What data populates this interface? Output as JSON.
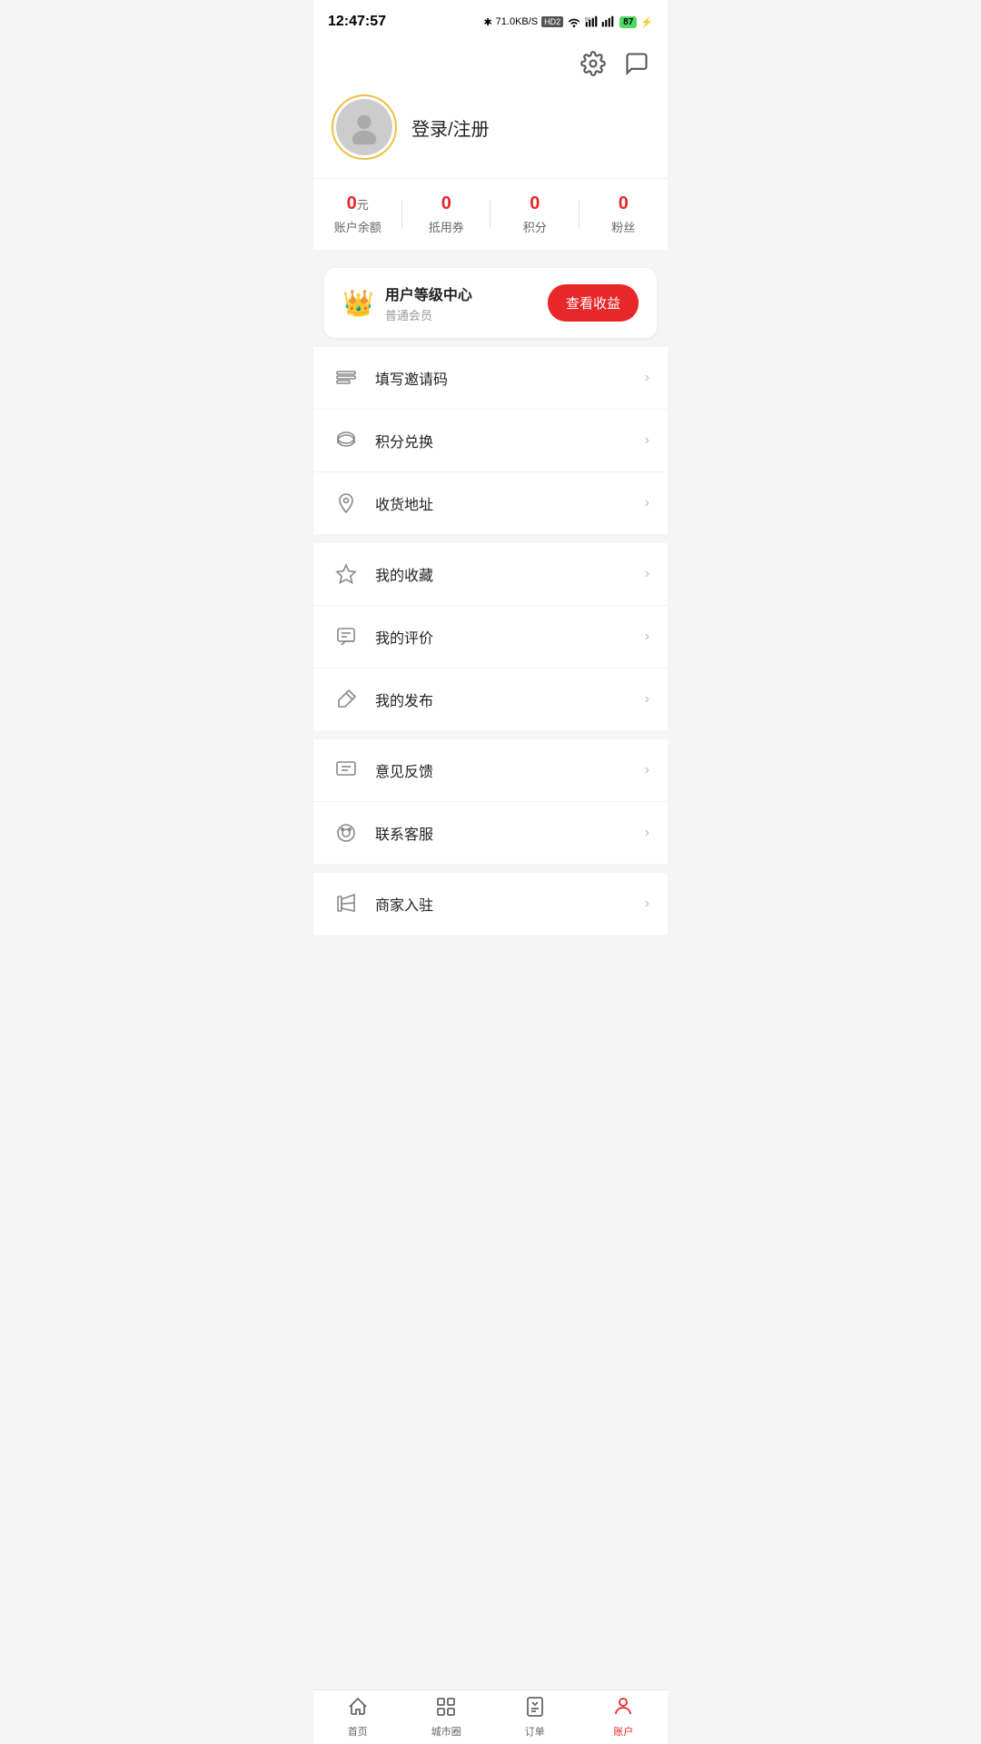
{
  "statusBar": {
    "time": "12:47:57",
    "battery": "87",
    "icons": "bluetooth signal wifi 5g"
  },
  "header": {
    "settingsLabel": "settings",
    "messageLabel": "message"
  },
  "profile": {
    "loginText": "登录/注册",
    "avatarAlt": "avatar"
  },
  "stats": [
    {
      "value": "0",
      "unit": "元",
      "label": "账户余额"
    },
    {
      "value": "0",
      "unit": "",
      "label": "抵用券"
    },
    {
      "value": "0",
      "unit": "",
      "label": "积分"
    },
    {
      "value": "0",
      "unit": "",
      "label": "粉丝"
    }
  ],
  "levelCard": {
    "title": "用户等级中心",
    "subtitle": "普通会员",
    "btnLabel": "查看收益"
  },
  "menuGroups": [
    {
      "items": [
        {
          "id": "invite-code",
          "label": "填写邀请码",
          "icon": "invite"
        },
        {
          "id": "points-exchange",
          "label": "积分兑换",
          "icon": "points"
        },
        {
          "id": "shipping-address",
          "label": "收货地址",
          "icon": "address"
        }
      ]
    },
    {
      "items": [
        {
          "id": "my-favorites",
          "label": "我的收藏",
          "icon": "star"
        },
        {
          "id": "my-reviews",
          "label": "我的评价",
          "icon": "review"
        },
        {
          "id": "my-posts",
          "label": "我的发布",
          "icon": "post"
        }
      ]
    },
    {
      "items": [
        {
          "id": "feedback",
          "label": "意见反馈",
          "icon": "feedback"
        },
        {
          "id": "customer-service",
          "label": "联系客服",
          "icon": "service"
        }
      ]
    },
    {
      "items": [
        {
          "id": "merchant-join",
          "label": "商家入驻",
          "icon": "merchant"
        }
      ]
    }
  ],
  "bottomNav": [
    {
      "id": "home",
      "label": "首页",
      "icon": "home",
      "active": false
    },
    {
      "id": "city-circle",
      "label": "城市圈",
      "icon": "grid",
      "active": false
    },
    {
      "id": "orders",
      "label": "订单",
      "icon": "order",
      "active": false
    },
    {
      "id": "account",
      "label": "账户",
      "icon": "user",
      "active": true
    }
  ]
}
